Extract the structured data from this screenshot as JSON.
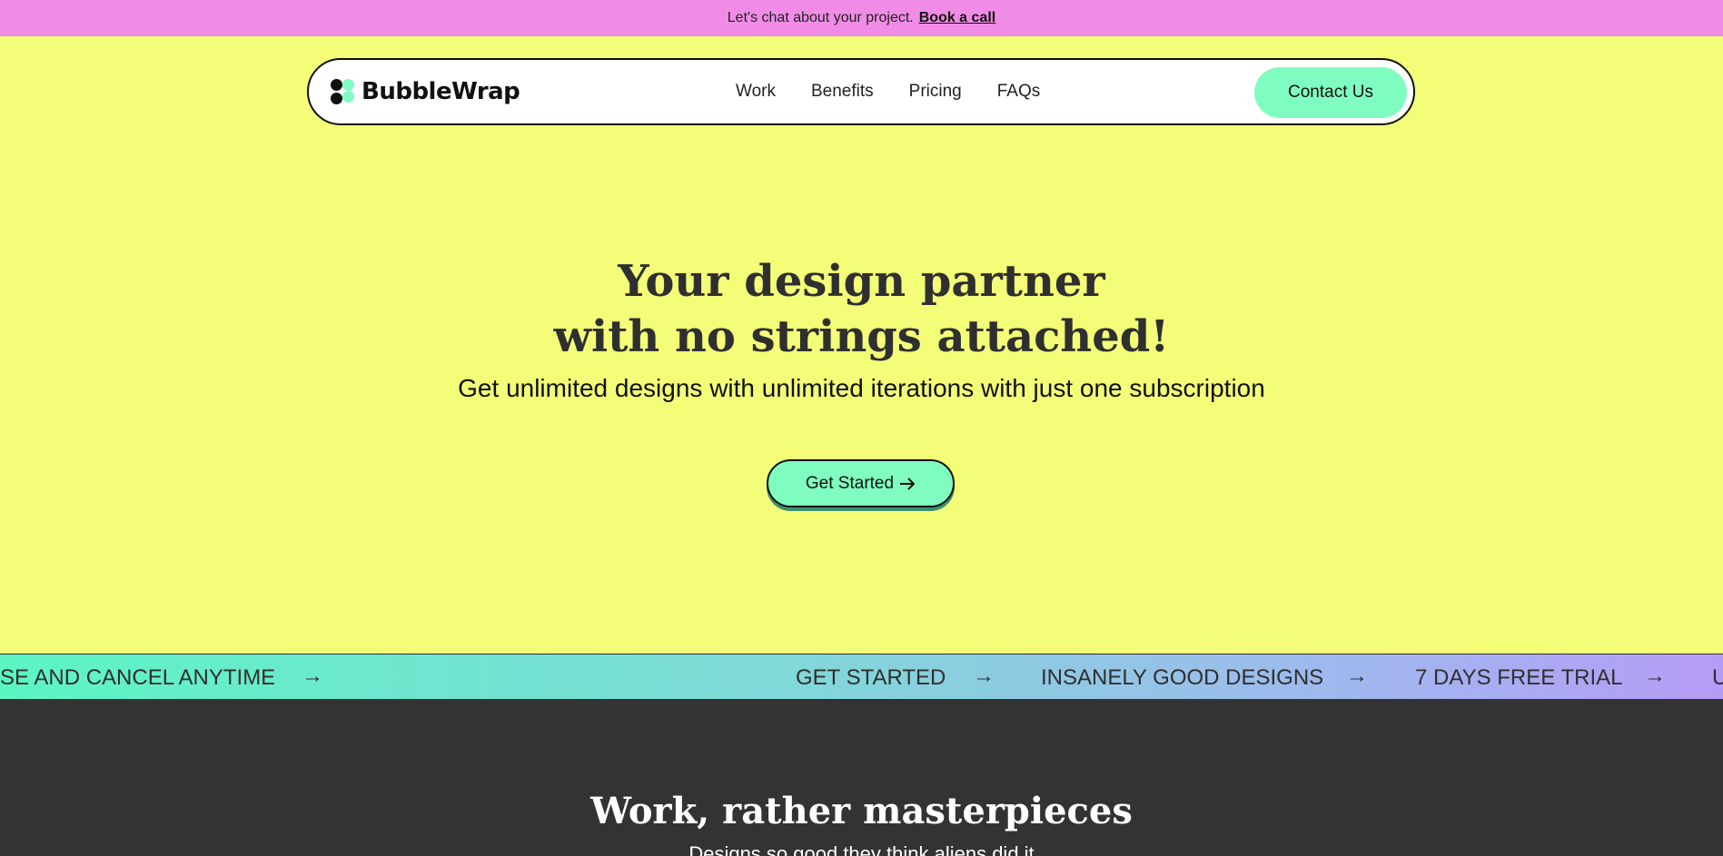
{
  "announcement": {
    "text": "Let's chat about your project.",
    "link": "Book a call"
  },
  "nav": {
    "logo": "BubbleWrap",
    "links": [
      "Work",
      "Benefits",
      "Pricing",
      "FAQs"
    ],
    "contact": "Contact Us"
  },
  "hero": {
    "title_line1": "Your design partner",
    "title_line2": "with no strings attached!",
    "subtitle": "Get unlimited designs with unlimited iterations with just one subscription",
    "cta": "Get Started",
    "cta_icon": "arrow-right-icon"
  },
  "marquee": {
    "items": [
      "SE AND CANCEL ANYTIME",
      "GET STARTED",
      "INSANELY GOOD DESIGNS",
      "7 DAYS FREE TRIAL",
      "U"
    ],
    "arrow": "→"
  },
  "work": {
    "title": "Work, rather masterpieces",
    "subtitle": "Designs so good they think aliens did it"
  },
  "colors": {
    "announcement_bg": "#f08ce6",
    "page_bg": "#f3fd78",
    "accent_mint": "#7ffdc0",
    "dark_section": "#333333"
  }
}
